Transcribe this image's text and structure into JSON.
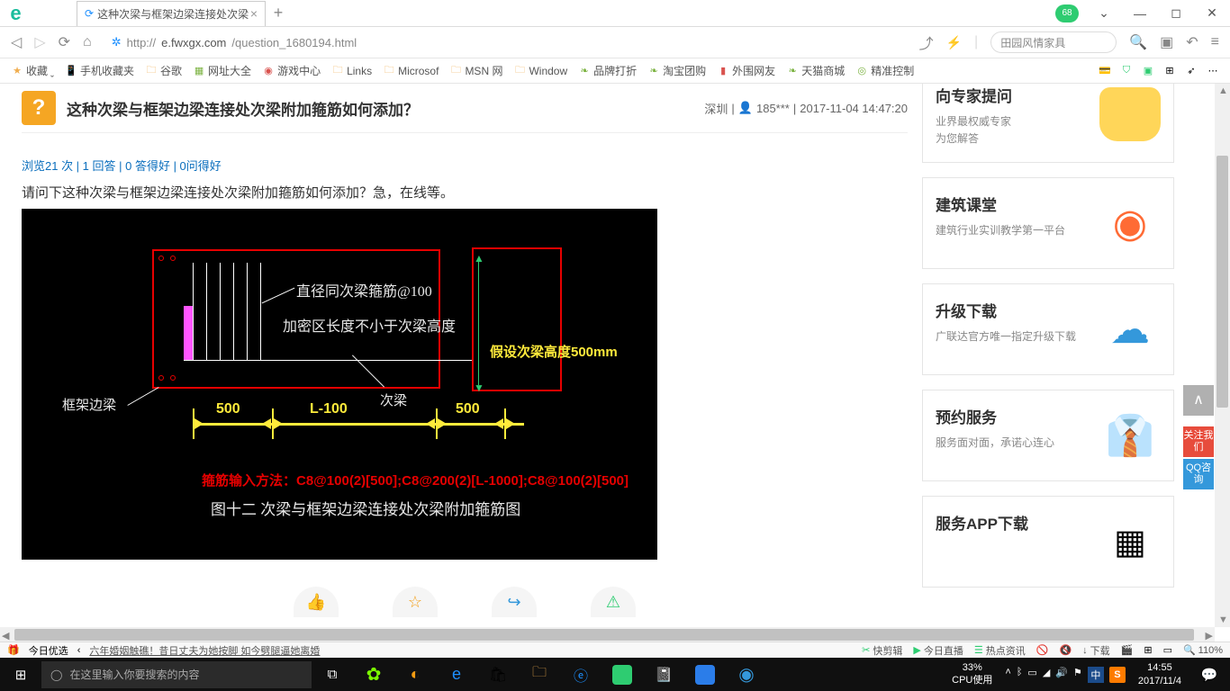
{
  "browser": {
    "tab_title": "这种次梁与框架边梁连接处次梁",
    "badge": "68",
    "url_prefix": "http://",
    "url_host": "e.fwxgx.com",
    "url_path": "/question_1680194.html",
    "search_placeholder": "田园风情家具"
  },
  "bookmarks": {
    "fav": "收藏",
    "items": [
      "手机收藏夹",
      "谷歌",
      "网址大全",
      "游戏中心",
      "Links",
      "Microsof",
      "MSN 网",
      "Window",
      "品牌打折",
      "淘宝团购",
      "外围网友",
      "天猫商城",
      "精准控制"
    ]
  },
  "question": {
    "title": "这种次梁与框架边梁连接处次梁附加箍筋如何添加？",
    "location": "深圳",
    "user": "185***",
    "time": "2017-11-04 14:47:20",
    "stats": "浏览21 次 | 1 回答 | 0 答得好 | 0问得好",
    "body": "请问下这种次梁与框架边梁连接处次梁附加箍筋如何添加？急，在线等。"
  },
  "cad": {
    "anno1": "直径同次梁箍筋@100",
    "anno2": "加密区长度不小于次梁高度",
    "label_side": "框架边梁",
    "label_sub": "次梁",
    "assume": "假设次梁高度500mm",
    "d1": "500",
    "d2": "L-100",
    "d3": "500",
    "method": "箍筋输入方法：C8@100(2)[500];C8@200(2)[L-1000];C8@100(2)[500]",
    "figcap": "图十二  次梁与框架边梁连接处次梁附加箍筋图"
  },
  "sidebar": {
    "c0": {
      "t": "向专家提问",
      "d": "业界最权威专家\n为您解答"
    },
    "c1": {
      "t": "建筑课堂",
      "d": "建筑行业实训教学第一平台"
    },
    "c2": {
      "t": "升级下载",
      "d": "广联达官方唯一指定升级下载"
    },
    "c3": {
      "t": "预约服务",
      "d": "服务面对面，承诺心连心"
    },
    "c4": {
      "t": "服务APP下载"
    }
  },
  "float": {
    "top": "∧",
    "follow": "关注我们",
    "qq": "QQ咨询"
  },
  "status": {
    "today": "今日优选",
    "news": "六年婚姻触礁！昔日丈夫为她按脚 如今劈腿逼她离婚",
    "items": [
      "快剪辑",
      "今日直播",
      "热点资讯"
    ],
    "dl": "下载",
    "zoom": "110%"
  },
  "taskbar": {
    "search": "在这里输入你要搜索的内容",
    "cpu_pct": "33%",
    "cpu_lbl": "CPU使用",
    "time": "14:55",
    "date": "2017/11/4",
    "ime": "中",
    "sogou": "S"
  }
}
